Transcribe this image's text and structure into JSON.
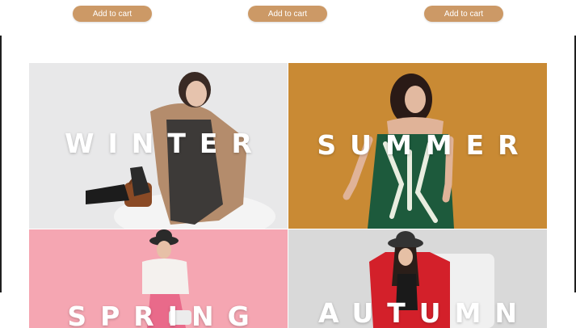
{
  "product_row": {
    "buttons": [
      {
        "label": "Add to cart"
      },
      {
        "label": "Add to cart"
      },
      {
        "label": "Add to cart"
      }
    ]
  },
  "seasons": {
    "tiles": [
      {
        "label": "WINTER"
      },
      {
        "label": "SUMMER"
      },
      {
        "label": "SPRING"
      },
      {
        "label": "AUTUMN"
      }
    ]
  },
  "colors": {
    "accent_button": "#cc9966",
    "winter_bg": "#e9e9ea",
    "summer_bg": "#c98a34",
    "spring_bg": "#f5a6b2",
    "autumn_bg": "#d6d6d6"
  }
}
